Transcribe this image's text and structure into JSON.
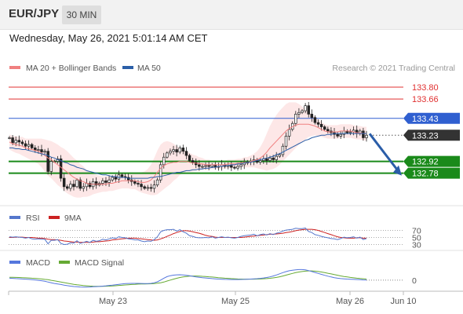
{
  "header": {
    "pair": "EUR/JPY",
    "timeframe": "30 MIN"
  },
  "datetime": "Wednesday, May 26, 2021 5:01:14 AM CET",
  "legend": {
    "ma20_label": "MA 20 + Bollinger Bands",
    "ma50_label": "MA 50",
    "credit": "Research © 2021 Trading Central",
    "rsi_label": "RSI",
    "rsi_ma_label": "9MA",
    "macd_label": "MACD",
    "macd_signal_label": "MACD Signal"
  },
  "colors": {
    "ma20": "#f08080",
    "ma50": "#2b5fa8",
    "band_fill": "#fde3e3",
    "resistance": "#e03030",
    "pivot": "#2f5fd0",
    "support": "#1a8a1a",
    "current_tag": "#333333",
    "arrow": "#2a5da8",
    "rsi": "#5577cc",
    "rsi_ma": "#cc2222",
    "macd": "#5577dd",
    "macd_signal": "#66aa33"
  },
  "chart_data": [
    {
      "type": "line",
      "panel": "price",
      "title": "EUR/JPY",
      "x_ticks": [
        "May 23",
        "May 25",
        "May 26",
        "Jun 10"
      ],
      "ylim": [
        132.46,
        133.94
      ],
      "levels": [
        {
          "value": 133.8,
          "label": "133.80",
          "kind": "resistance"
        },
        {
          "value": 133.66,
          "label": "133.66",
          "kind": "resistance"
        },
        {
          "value": 133.43,
          "label": "133.43",
          "kind": "pivot"
        },
        {
          "value": 133.23,
          "label": "133.23",
          "kind": "current"
        },
        {
          "value": 132.92,
          "label": "132.92",
          "kind": "support"
        },
        {
          "value": 132.78,
          "label": "132.78",
          "kind": "support"
        }
      ],
      "last_price": 133.23,
      "forecast_target": 132.78,
      "close": [
        133.2,
        133.14,
        133.17,
        133.15,
        133.13,
        133.1,
        133.12,
        133.08,
        133.05,
        133.06,
        133.03,
        133.04,
        132.8,
        132.92,
        132.92,
        132.95,
        132.72,
        132.62,
        132.6,
        132.65,
        132.62,
        132.7,
        132.6,
        132.62,
        132.66,
        132.62,
        132.68,
        132.64,
        132.66,
        132.69,
        132.67,
        132.7,
        132.73,
        132.71,
        132.76,
        132.74,
        132.73,
        132.7,
        132.68,
        132.66,
        132.65,
        132.62,
        132.6,
        132.61,
        132.6,
        132.64,
        132.7,
        132.88,
        132.97,
        133.02,
        133.04,
        133.06,
        133.03,
        133.08,
        133.04,
        132.99,
        132.93,
        132.91,
        132.88,
        132.86,
        132.86,
        132.87,
        132.86,
        132.88,
        132.85,
        132.86,
        132.88,
        132.86,
        132.87,
        132.85,
        132.84,
        132.86,
        132.88,
        132.9,
        132.91,
        132.92,
        132.94,
        132.91,
        132.93,
        132.95,
        132.93,
        132.96,
        132.94,
        132.98,
        133.0,
        133.1,
        133.22,
        133.3,
        133.37,
        133.48,
        133.5,
        133.52,
        133.58,
        133.48,
        133.44,
        133.38,
        133.36,
        133.33,
        133.3,
        133.28,
        133.26,
        133.24,
        133.22,
        133.24,
        133.28,
        133.26,
        133.27,
        133.29,
        133.25,
        133.28,
        133.2,
        133.23
      ],
      "ma20": [
        133.15,
        133.13,
        133.12,
        133.11,
        133.1,
        133.08,
        133.07,
        133.06,
        133.05,
        133.04,
        133.02,
        132.99,
        132.96,
        132.94,
        132.91,
        132.88,
        132.85,
        132.82,
        132.79,
        132.76,
        132.73,
        132.71,
        132.69,
        132.68,
        132.66,
        132.65,
        132.65,
        132.65,
        132.65,
        132.65,
        132.65,
        132.66,
        132.66,
        132.67,
        132.68,
        132.69,
        132.69,
        132.69,
        132.69,
        132.69,
        132.68,
        132.67,
        132.67,
        132.68,
        132.7,
        132.74,
        132.79,
        132.84,
        132.87,
        132.89,
        132.9,
        132.91,
        132.91,
        132.92,
        132.92,
        132.92,
        132.91,
        132.9,
        132.9,
        132.89,
        132.89,
        132.88,
        132.88,
        132.88,
        132.88,
        132.88,
        132.88,
        132.88,
        132.89,
        132.89,
        132.89,
        132.9,
        132.9,
        132.91,
        132.91,
        132.92,
        132.93,
        132.94,
        132.96,
        132.99,
        133.03,
        133.08,
        133.12,
        133.16,
        133.2,
        133.24,
        133.28,
        133.31,
        133.33,
        133.35,
        133.36,
        133.36,
        133.36,
        133.36,
        133.35,
        133.34,
        133.32,
        133.3,
        133.28,
        133.27,
        133.27,
        133.27,
        133.27,
        133.28,
        133.28,
        133.28,
        133.28,
        133.27,
        133.26,
        133.26,
        133.25,
        133.25
      ],
      "ma50": [
        133.08,
        133.08,
        133.07,
        133.07,
        133.06,
        133.06,
        133.05,
        133.04,
        133.03,
        133.02,
        133.01,
        133.0,
        132.99,
        132.97,
        132.96,
        132.94,
        132.93,
        132.91,
        132.9,
        132.88,
        132.87,
        132.85,
        132.84,
        132.83,
        132.81,
        132.8,
        132.79,
        132.78,
        132.77,
        132.76,
        132.76,
        132.75,
        132.74,
        132.74,
        132.73,
        132.73,
        132.73,
        132.72,
        132.72,
        132.72,
        132.72,
        132.72,
        132.72,
        132.72,
        132.73,
        132.73,
        132.74,
        132.74,
        132.75,
        132.76,
        132.77,
        132.78,
        132.79,
        132.79,
        132.8,
        132.81,
        132.81,
        132.82,
        132.82,
        132.83,
        132.83,
        132.84,
        132.84,
        132.85,
        132.85,
        132.86,
        132.86,
        132.87,
        132.87,
        132.88,
        132.88,
        132.89,
        132.89,
        132.9,
        132.91,
        132.91,
        132.92,
        132.93,
        132.94,
        132.95,
        132.96,
        132.97,
        132.98,
        133.0,
        133.01,
        133.03,
        133.05,
        133.07,
        133.09,
        133.11,
        133.13,
        133.15,
        133.17,
        133.18,
        133.2,
        133.21,
        133.22,
        133.23,
        133.23,
        133.24,
        133.24,
        133.25,
        133.25,
        133.25,
        133.25,
        133.25,
        133.25,
        133.25,
        133.25,
        133.25,
        133.25,
        133.25
      ],
      "band_width": [
        0.09,
        0.09,
        0.1,
        0.1,
        0.11,
        0.11,
        0.12,
        0.13,
        0.14,
        0.15,
        0.17,
        0.19,
        0.21,
        0.22,
        0.23,
        0.24,
        0.24,
        0.25,
        0.25,
        0.24,
        0.23,
        0.22,
        0.2,
        0.18,
        0.16,
        0.14,
        0.12,
        0.11,
        0.1,
        0.09,
        0.09,
        0.09,
        0.09,
        0.09,
        0.09,
        0.09,
        0.09,
        0.09,
        0.1,
        0.1,
        0.11,
        0.12,
        0.13,
        0.15,
        0.18,
        0.22,
        0.26,
        0.28,
        0.28,
        0.27,
        0.25,
        0.22,
        0.19,
        0.16,
        0.14,
        0.12,
        0.11,
        0.1,
        0.09,
        0.08,
        0.07,
        0.06,
        0.06,
        0.05,
        0.05,
        0.05,
        0.05,
        0.05,
        0.05,
        0.05,
        0.05,
        0.05,
        0.05,
        0.06,
        0.06,
        0.07,
        0.08,
        0.1,
        0.13,
        0.17,
        0.22,
        0.26,
        0.29,
        0.31,
        0.32,
        0.32,
        0.32,
        0.31,
        0.29,
        0.27,
        0.24,
        0.21,
        0.18,
        0.15,
        0.13,
        0.11,
        0.1,
        0.09,
        0.08,
        0.08,
        0.08,
        0.08,
        0.08,
        0.08,
        0.08,
        0.08,
        0.08,
        0.08,
        0.08,
        0.08,
        0.08,
        0.08
      ]
    },
    {
      "type": "line",
      "panel": "rsi",
      "y_ticks": [
        {
          "value": 70,
          "label": "70"
        },
        {
          "value": 50,
          "label": "50"
        },
        {
          "value": 30,
          "label": "30"
        }
      ],
      "ylim": [
        20,
        80
      ],
      "rsi": [
        52,
        51,
        52,
        51,
        50,
        48,
        50,
        46,
        45,
        46,
        45,
        45,
        32,
        42,
        42,
        44,
        33,
        30,
        31,
        35,
        34,
        41,
        33,
        36,
        39,
        36,
        42,
        39,
        41,
        45,
        43,
        46,
        49,
        47,
        52,
        50,
        49,
        46,
        45,
        43,
        43,
        40,
        38,
        40,
        39,
        44,
        52,
        66,
        70,
        72,
        72,
        73,
        68,
        72,
        66,
        62,
        55,
        53,
        50,
        49,
        49,
        50,
        49,
        52,
        48,
        50,
        52,
        50,
        51,
        49,
        48,
        50,
        53,
        55,
        56,
        57,
        59,
        55,
        58,
        60,
        57,
        61,
        58,
        62,
        64,
        68,
        71,
        72,
        73,
        76,
        75,
        75,
        77,
        67,
        64,
        58,
        56,
        53,
        51,
        49,
        47,
        46,
        44,
        47,
        51,
        49,
        50,
        52,
        48,
        51,
        44,
        47
      ],
      "rsi_ma": [
        50,
        50,
        51,
        51,
        51,
        50,
        50,
        50,
        49,
        48,
        48,
        47,
        45,
        44,
        44,
        43,
        42,
        40,
        39,
        38,
        37,
        37,
        36,
        36,
        36,
        36,
        37,
        38,
        38,
        39,
        40,
        41,
        43,
        44,
        45,
        46,
        47,
        48,
        48,
        48,
        47,
        46,
        45,
        44,
        43,
        42,
        43,
        46,
        49,
        53,
        57,
        61,
        64,
        67,
        69,
        69,
        68,
        66,
        64,
        62,
        59,
        56,
        54,
        53,
        51,
        50,
        50,
        50,
        50,
        50,
        50,
        50,
        50,
        51,
        52,
        53,
        54,
        55,
        56,
        57,
        58,
        59,
        59,
        60,
        61,
        62,
        64,
        65,
        67,
        69,
        71,
        72,
        73,
        73,
        73,
        72,
        70,
        67,
        64,
        61,
        58,
        55,
        52,
        50,
        49,
        48,
        48,
        48,
        49,
        49,
        48,
        48
      ]
    },
    {
      "type": "line",
      "panel": "macd",
      "y_ticks": [
        {
          "value": 0,
          "label": "0"
        }
      ],
      "ylim": [
        -0.1,
        0.13
      ],
      "macd": [
        0.02,
        0.018,
        0.016,
        0.014,
        0.012,
        0.01,
        0.008,
        0.005,
        0.002,
        -0.002,
        -0.006,
        -0.012,
        -0.02,
        -0.028,
        -0.035,
        -0.04,
        -0.046,
        -0.052,
        -0.058,
        -0.063,
        -0.067,
        -0.07,
        -0.072,
        -0.073,
        -0.073,
        -0.072,
        -0.07,
        -0.068,
        -0.066,
        -0.063,
        -0.06,
        -0.056,
        -0.052,
        -0.048,
        -0.044,
        -0.04,
        -0.037,
        -0.035,
        -0.034,
        -0.034,
        -0.034,
        -0.035,
        -0.036,
        -0.036,
        -0.034,
        -0.028,
        -0.018,
        0.0,
        0.02,
        0.036,
        0.046,
        0.052,
        0.055,
        0.056,
        0.054,
        0.05,
        0.045,
        0.04,
        0.034,
        0.03,
        0.026,
        0.022,
        0.019,
        0.016,
        0.013,
        0.011,
        0.009,
        0.008,
        0.007,
        0.006,
        0.006,
        0.006,
        0.007,
        0.008,
        0.009,
        0.011,
        0.013,
        0.015,
        0.018,
        0.022,
        0.027,
        0.034,
        0.043,
        0.054,
        0.066,
        0.078,
        0.089,
        0.098,
        0.104,
        0.108,
        0.11,
        0.11,
        0.107,
        0.1,
        0.09,
        0.08,
        0.07,
        0.06,
        0.05,
        0.041,
        0.033,
        0.026,
        0.02,
        0.016,
        0.013,
        0.011,
        0.009,
        0.008,
        0.006,
        0.004,
        0.002,
        0.0
      ],
      "signal": [
        0.03,
        0.029,
        0.028,
        0.027,
        0.026,
        0.024,
        0.022,
        0.02,
        0.018,
        0.015,
        0.012,
        0.008,
        0.004,
        -0.002,
        -0.008,
        -0.014,
        -0.02,
        -0.026,
        -0.032,
        -0.038,
        -0.044,
        -0.049,
        -0.053,
        -0.057,
        -0.06,
        -0.062,
        -0.064,
        -0.065,
        -0.065,
        -0.065,
        -0.064,
        -0.063,
        -0.061,
        -0.059,
        -0.056,
        -0.054,
        -0.051,
        -0.048,
        -0.046,
        -0.044,
        -0.042,
        -0.041,
        -0.04,
        -0.039,
        -0.038,
        -0.036,
        -0.033,
        -0.028,
        -0.02,
        -0.01,
        0.0,
        0.01,
        0.019,
        0.027,
        0.033,
        0.038,
        0.041,
        0.043,
        0.043,
        0.042,
        0.04,
        0.038,
        0.035,
        0.032,
        0.029,
        0.026,
        0.023,
        0.02,
        0.018,
        0.016,
        0.014,
        0.012,
        0.011,
        0.01,
        0.01,
        0.01,
        0.01,
        0.011,
        0.012,
        0.014,
        0.016,
        0.019,
        0.023,
        0.028,
        0.035,
        0.043,
        0.052,
        0.061,
        0.07,
        0.078,
        0.085,
        0.09,
        0.094,
        0.096,
        0.096,
        0.094,
        0.09,
        0.085,
        0.079,
        0.072,
        0.065,
        0.058,
        0.051,
        0.044,
        0.038,
        0.033,
        0.028,
        0.024,
        0.02,
        0.017,
        0.014,
        0.011
      ]
    }
  ]
}
